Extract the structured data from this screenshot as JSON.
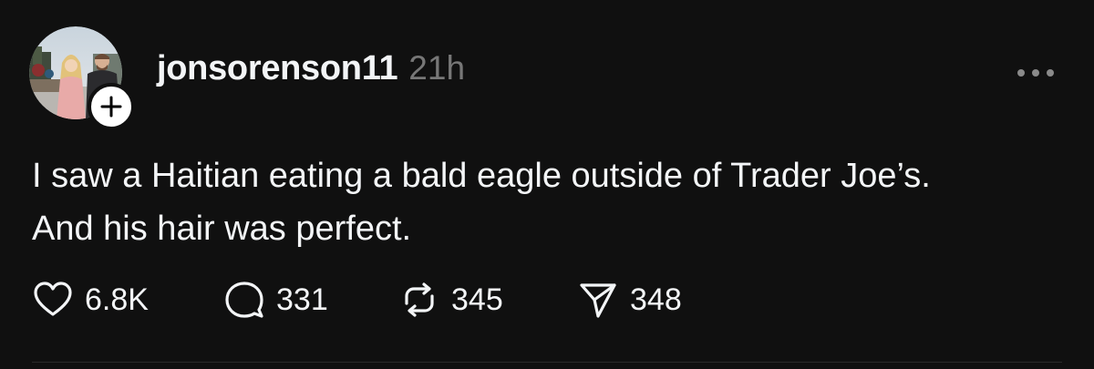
{
  "post": {
    "username": "jonsorenson11",
    "timestamp": "21h",
    "text_lines": [
      "I saw a Haitian eating a bald eagle outside of Trader Joe’s.",
      "And his hair was perfect."
    ],
    "stats": {
      "likes": "6.8K",
      "replies": "331",
      "reposts": "345",
      "shares": "348"
    }
  },
  "icons": {
    "like": "heart-icon",
    "reply": "speech-bubble-icon",
    "repost": "repost-arrows-icon",
    "share": "paper-plane-icon",
    "more": "ellipsis-icon",
    "follow": "plus-icon"
  },
  "colors": {
    "background": "#101010",
    "text": "#f3f5f7",
    "muted": "#777777"
  }
}
